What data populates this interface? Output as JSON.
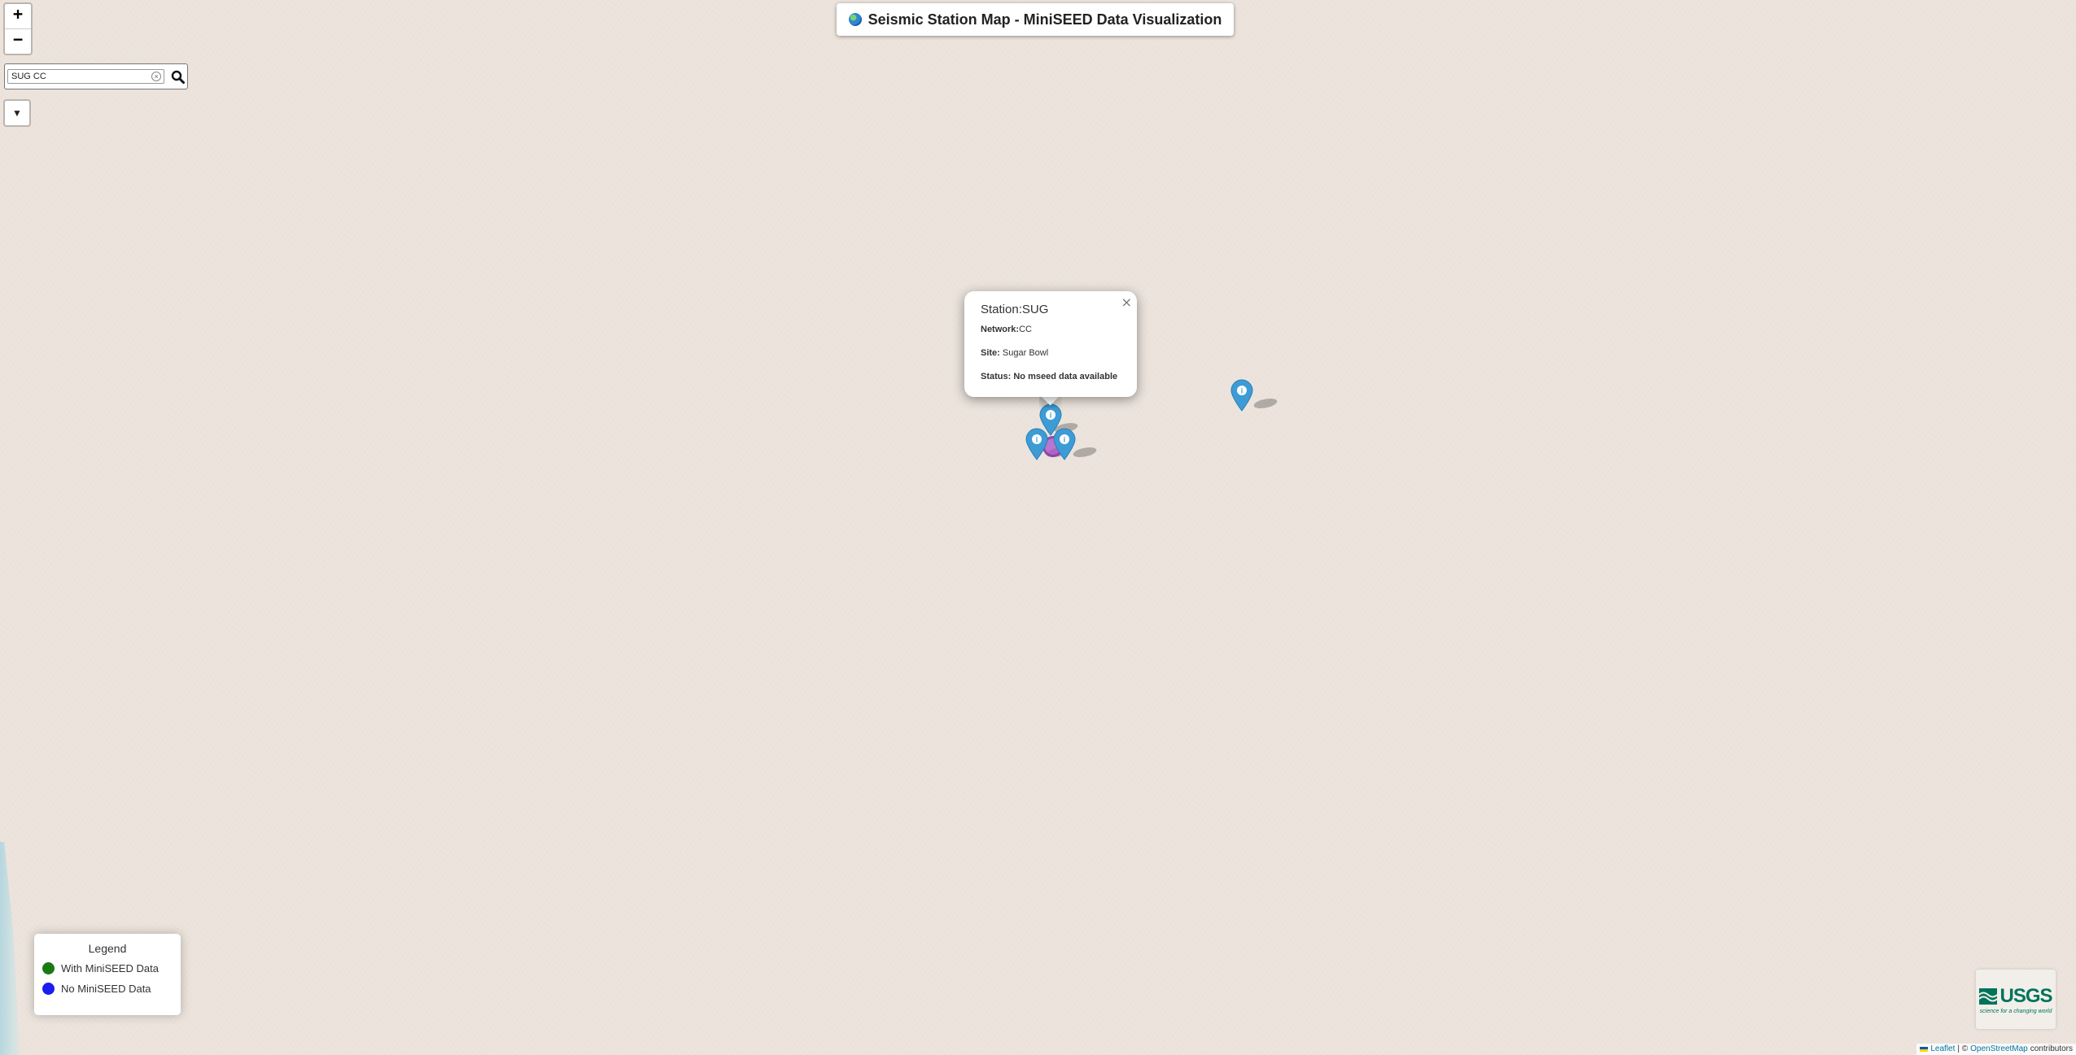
{
  "title": {
    "icon": "globe-icon",
    "text": "Seismic Station Map - MiniSEED Data Visualization"
  },
  "zoom": {
    "in_label": "+",
    "out_label": "−"
  },
  "search": {
    "value": "SUG CC",
    "clear_icon": "clear-icon",
    "button_icon": "search-icon"
  },
  "filter": {
    "icon": "filter-icon",
    "label": "▼"
  },
  "popup": {
    "close_label": "×",
    "station_label": "Station:",
    "station_value": "SUG",
    "network_label": "Network:",
    "network_value": "CC",
    "site_label": "Site: ",
    "site_value": "Sugar Bowl",
    "status_label": "Status: ",
    "status_value": "No mseed data available"
  },
  "markers": [
    {
      "name": "station-marker-sug",
      "icon": "info-icon",
      "symbol": "i",
      "color": "#3d9bd6"
    },
    {
      "name": "station-marker-left",
      "icon": "info-icon",
      "symbol": "i",
      "color": "#3d9bd6"
    },
    {
      "name": "station-marker-right",
      "icon": "info-icon",
      "symbol": "i",
      "color": "#3d9bd6"
    },
    {
      "name": "station-marker-east",
      "icon": "info-icon",
      "symbol": "i",
      "color": "#3d9bd6"
    }
  ],
  "legend": {
    "title": "Legend",
    "items": [
      {
        "label": "With MiniSEED Data",
        "color": "#1a7a12"
      },
      {
        "label": "No MiniSEED Data",
        "color": "#1c1cf0"
      }
    ]
  },
  "logo": {
    "text": "USGS",
    "tagline": "science for a changing world"
  },
  "attribution": {
    "leaflet": "Leaflet",
    "separator": " | © ",
    "osm": "OpenStreetMap",
    "suffix": " contributors"
  }
}
